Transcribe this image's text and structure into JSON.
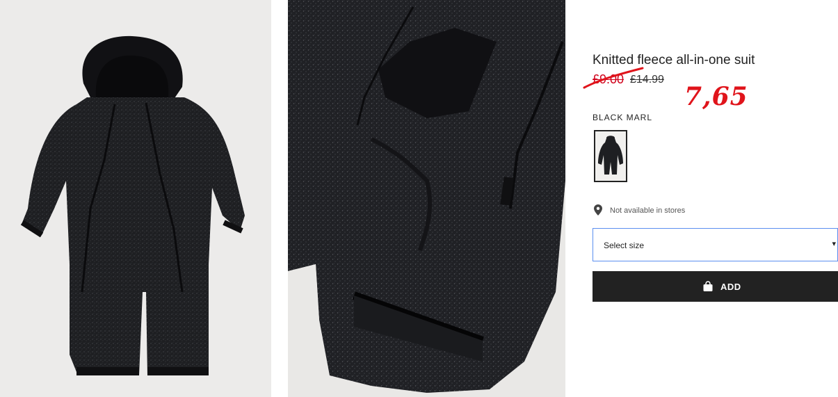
{
  "product": {
    "title": "Knitted fleece all-in-one suit",
    "price_sale": "£9.00",
    "price_original": "£14.99",
    "price_handwritten": "7,65",
    "color_label": "BLACK MARL",
    "availability": "Not available in stores",
    "size_placeholder": "Select size",
    "add_label": "ADD"
  },
  "images": {
    "main": "product-photo-front",
    "detail": "product-photo-detail"
  },
  "icons": {
    "location": "location-pin-icon",
    "bag": "shopping-bag-icon",
    "dropdown": "chevron-down-icon"
  },
  "colors": {
    "sale_red": "#d0021b",
    "annotation_red": "#e0141b",
    "button_dark": "#222222",
    "select_border": "#5b8ff0"
  }
}
